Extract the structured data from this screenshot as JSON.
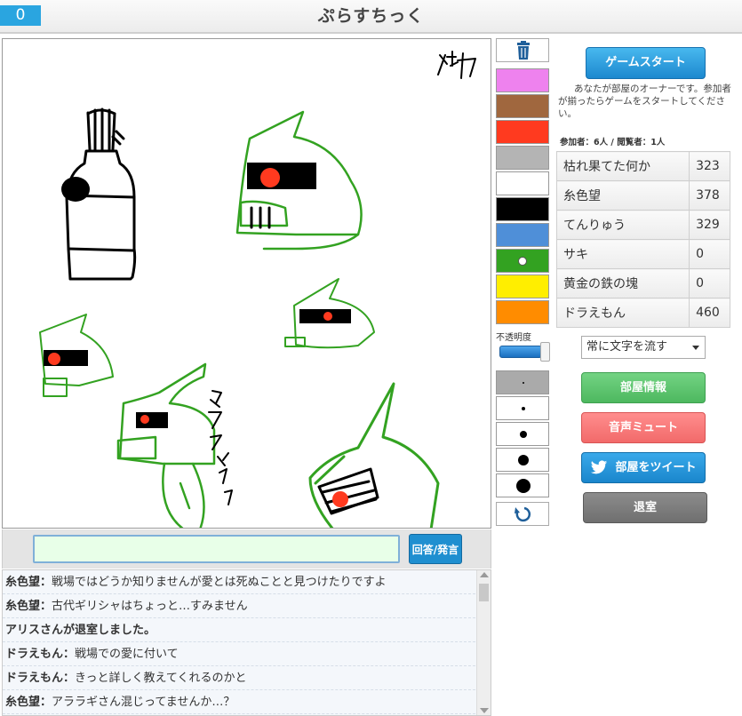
{
  "header": {
    "timer": "0",
    "title": "ぷらすちっく"
  },
  "colors": {
    "palette": [
      "#ee82ee",
      "#a0673e",
      "#ff3a1f",
      "#b4b4b4",
      "#ffffff",
      "#000000",
      "#4f8fd8",
      "#33a221",
      "#ffee00",
      "#ff8c00"
    ],
    "selected_index": 7,
    "accent": "#2aa5e0"
  },
  "tools": {
    "trash_icon": "trash-icon",
    "opacity_label": "不透明度",
    "opacity_level": 1.0,
    "pen_sizes": [
      "tiny",
      "small",
      "medium",
      "large",
      "xlarge"
    ],
    "selected_pen": 0,
    "undo_icon": "undo-icon"
  },
  "canvas": {
    "annotation_top": "ザケ",
    "annotation_side": "アララギザク"
  },
  "input": {
    "value": "",
    "submit_label": "回答/発言"
  },
  "chat": [
    {
      "name": "糸色望",
      "sep": "：",
      "text": "戦場ではどうか知りませんが愛とは死ぬことと見つけたりですよ"
    },
    {
      "name": "糸色望",
      "sep": "：",
      "text": "古代ギリシャはちょっと…すみません"
    },
    {
      "system": "アリスさんが退室しました。"
    },
    {
      "name": "ドラえもん",
      "sep": "：",
      "text": "戦場での愛に付いて"
    },
    {
      "name": "ドラえもん",
      "sep": "：",
      "text": "きっと詳しく教えてくれるのかと"
    },
    {
      "name": "糸色望",
      "sep": "：",
      "text": "アララギさん混じってませんか…？"
    }
  ],
  "panel": {
    "start_label": "ゲームスタート",
    "owner_note": "あなたが部屋のオーナーです。参加者が揃ったらゲームをスタートしてください。",
    "counts": "参加者：6人 / 閲覧者：1人",
    "players": [
      {
        "name": "枯れ果てた何か",
        "score": "323"
      },
      {
        "name": "糸色望",
        "score": "378"
      },
      {
        "name": "てんりゅう",
        "score": "329"
      },
      {
        "name": "サキ",
        "score": "0"
      },
      {
        "name": "黄金の鉄の塊",
        "score": "0"
      },
      {
        "name": "ドラえもん",
        "score": "460"
      }
    ],
    "flow_option": "常に文字を流す",
    "room_info_label": "部屋情報",
    "mute_label": "音声ミュート",
    "tweet_label": "部屋をツイート",
    "tweet_icon": "twitter-bird-icon",
    "leave_label": "退室"
  }
}
